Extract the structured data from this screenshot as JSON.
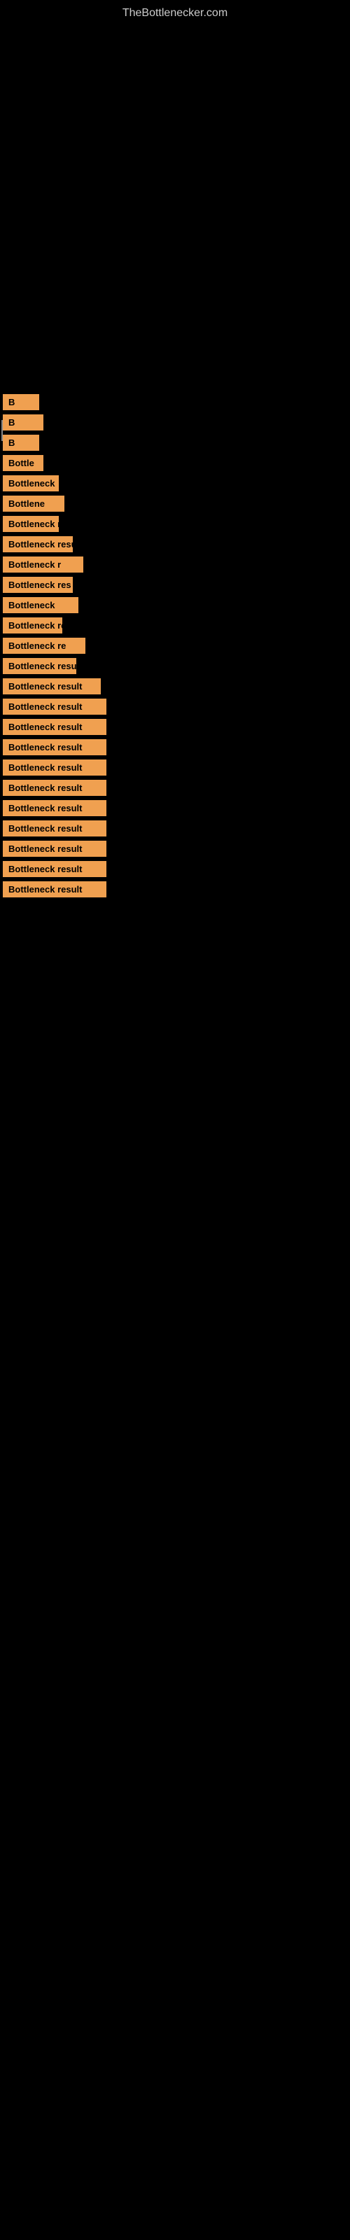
{
  "site": {
    "title": "TheBottlenecker.com"
  },
  "items": [
    {
      "id": 1,
      "label": "B",
      "class": "item-1"
    },
    {
      "id": 2,
      "label": "B",
      "class": "item-2"
    },
    {
      "id": 3,
      "label": "B",
      "class": "item-3"
    },
    {
      "id": 4,
      "label": "Bottle",
      "class": "item-4"
    },
    {
      "id": 5,
      "label": "Bottleneck",
      "class": "item-5"
    },
    {
      "id": 6,
      "label": "Bottlene",
      "class": "item-6"
    },
    {
      "id": 7,
      "label": "Bottleneck r",
      "class": "item-7"
    },
    {
      "id": 8,
      "label": "Bottleneck resu",
      "class": "item-8"
    },
    {
      "id": 9,
      "label": "Bottleneck r",
      "class": "item-9"
    },
    {
      "id": 10,
      "label": "Bottleneck res",
      "class": "item-10"
    },
    {
      "id": 11,
      "label": "Bottleneck",
      "class": "item-11"
    },
    {
      "id": 12,
      "label": "Bottleneck resu",
      "class": "item-12"
    },
    {
      "id": 13,
      "label": "Bottleneck re",
      "class": "item-13"
    },
    {
      "id": 14,
      "label": "Bottleneck result",
      "class": "item-14"
    },
    {
      "id": 15,
      "label": "Bottleneck result",
      "class": "item-15"
    },
    {
      "id": 16,
      "label": "Bottleneck result",
      "class": "item-16"
    },
    {
      "id": 17,
      "label": "Bottleneck result",
      "class": "item-17"
    },
    {
      "id": 18,
      "label": "Bottleneck result",
      "class": "item-18"
    },
    {
      "id": 19,
      "label": "Bottleneck result",
      "class": "item-19"
    },
    {
      "id": 20,
      "label": "Bottleneck result",
      "class": "item-20"
    },
    {
      "id": 21,
      "label": "Bottleneck result",
      "class": "item-21"
    },
    {
      "id": 22,
      "label": "Bottleneck result",
      "class": "item-22"
    },
    {
      "id": 23,
      "label": "Bottleneck result",
      "class": "item-23"
    },
    {
      "id": 24,
      "label": "Bottleneck result",
      "class": "item-24"
    },
    {
      "id": 25,
      "label": "Bottleneck result",
      "class": "item-25"
    }
  ]
}
